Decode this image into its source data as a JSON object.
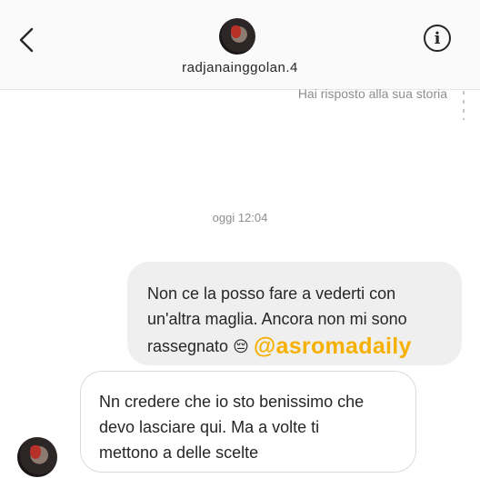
{
  "header": {
    "username": "radjanainggolan.4",
    "back_icon": "chevron-left-icon",
    "info_icon": "info-icon",
    "info_glyph": "i"
  },
  "thread": {
    "story_reply_label": "Hai risposto alla sua storia",
    "timestamp": "oggi 12:04",
    "outgoing": {
      "lines": [
        "Non ce la posso fare a vederti con",
        "un'altra maglia. Ancora non mi sono",
        "rassegnato"
      ],
      "emoji": "😔",
      "tag": "@asromadaily",
      "tag_color": "#f5b000"
    },
    "incoming": {
      "lines": [
        "Nn credere che io sto benissimo che",
        "devo lasciare qui. Ma a volte ti",
        "mettono a delle scelte"
      ]
    }
  }
}
